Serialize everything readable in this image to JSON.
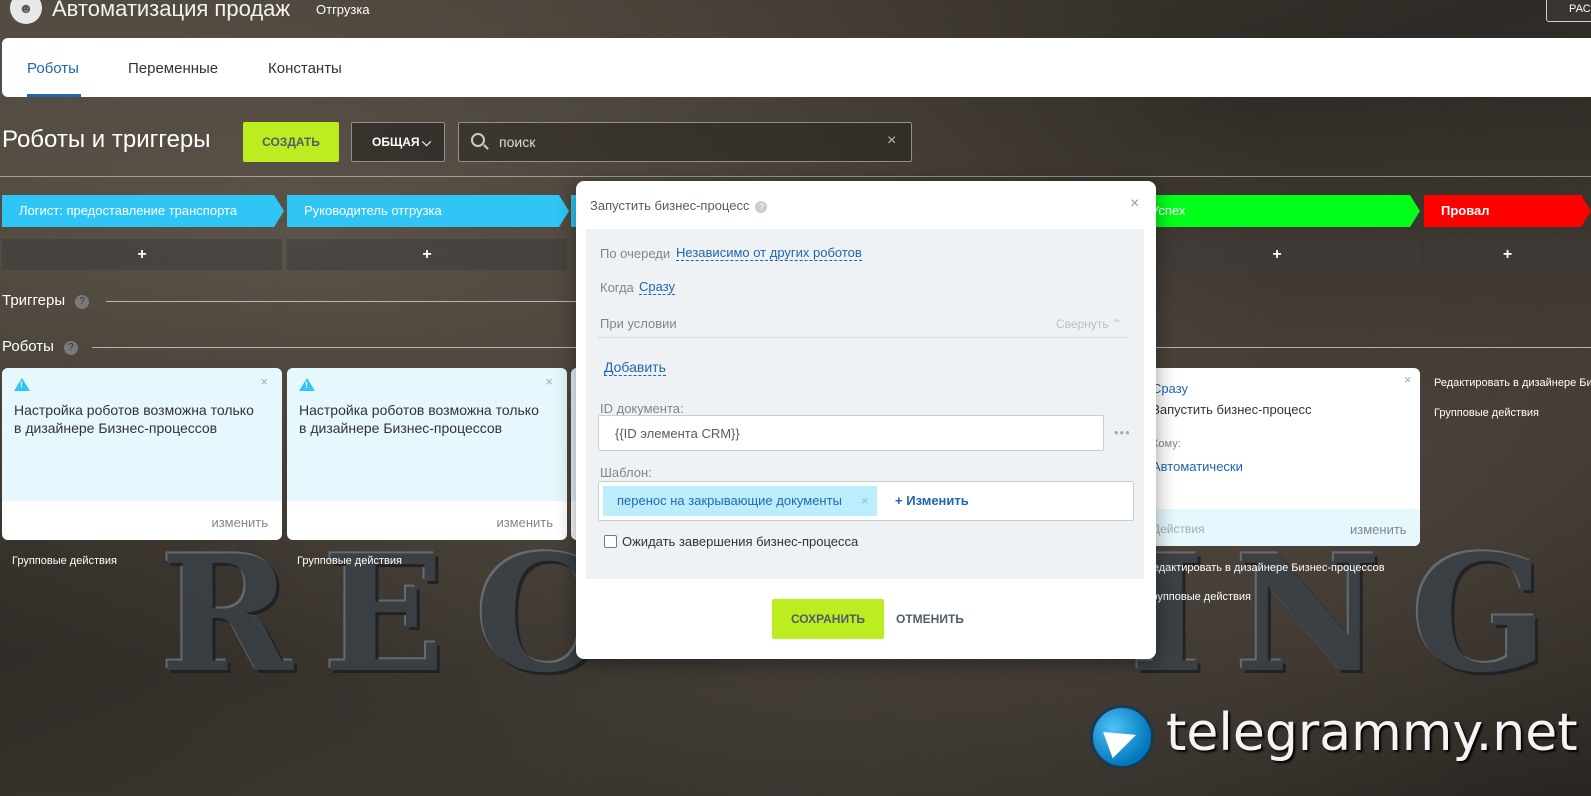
{
  "header": {
    "title": "Автоматизация продаж",
    "subtitle": "Отгрузка",
    "corner_label": "РАС"
  },
  "tabs": [
    {
      "label": "Роботы",
      "active": true
    },
    {
      "label": "Переменные",
      "active": false
    },
    {
      "label": "Константы",
      "active": false
    }
  ],
  "toolbar": {
    "page_title": "Роботы и триггеры",
    "create_label": "СОЗДАТЬ",
    "general_label": "ОБЩАЯ",
    "search_placeholder": "поиск"
  },
  "stages": [
    {
      "name": "Логист: предоставление транспорта",
      "color": "#2fc6f6"
    },
    {
      "name": "Руководитель отгрузка",
      "color": "#2fc6f6"
    },
    {
      "name": "Успех",
      "color": "#00ff1a"
    },
    {
      "name": "Провал",
      "color": "#ff0000"
    }
  ],
  "sections": {
    "triggers": "Триггеры",
    "robots": "Роботы"
  },
  "cards": [
    {
      "text": "Настройка роботов возможна только в дизайнере Бизнес-процессов",
      "edit": "изменить",
      "group": "Групповые действия"
    },
    {
      "text": "Настройка роботов возможна только в дизайнере Бизнес-процессов",
      "edit": "изменить",
      "group": "Групповые действия"
    }
  ],
  "right_card": {
    "when": "Сразу",
    "name": "Запустить бизнес-процесс",
    "to_label": "Кому:",
    "to_value": "Автоматически",
    "actions": "Действия",
    "edit": "изменить",
    "designer_link": "Редактировать в дизайнере Бизнес-процессов",
    "group": "Групповые действия",
    "side_designer": "Редактировать в дизайнере Би",
    "side_group": "Групповые действия"
  },
  "modal": {
    "title": "Запустить бизнес-процесс",
    "queue_label": "По очереди",
    "queue_value": "Независимо от других роботов",
    "when_label": "Когда",
    "when_value": "Сразу",
    "condition_label": "При условии",
    "collapse_label": "Свернуть",
    "add_label": "Добавить",
    "doc_id_label": "ID документа:",
    "doc_id_value": "{{ID элемента CRM}}",
    "template_label": "Шаблон:",
    "template_value": "перенос на закрывающие документы",
    "change_label": "Изменить",
    "wait_label": "Ожидать завершения бизнес-процесса",
    "save_label": "СОХРАНИТЬ",
    "cancel_label": "ОТМЕНИТЬ"
  },
  "watermark": "telegrammy.net"
}
